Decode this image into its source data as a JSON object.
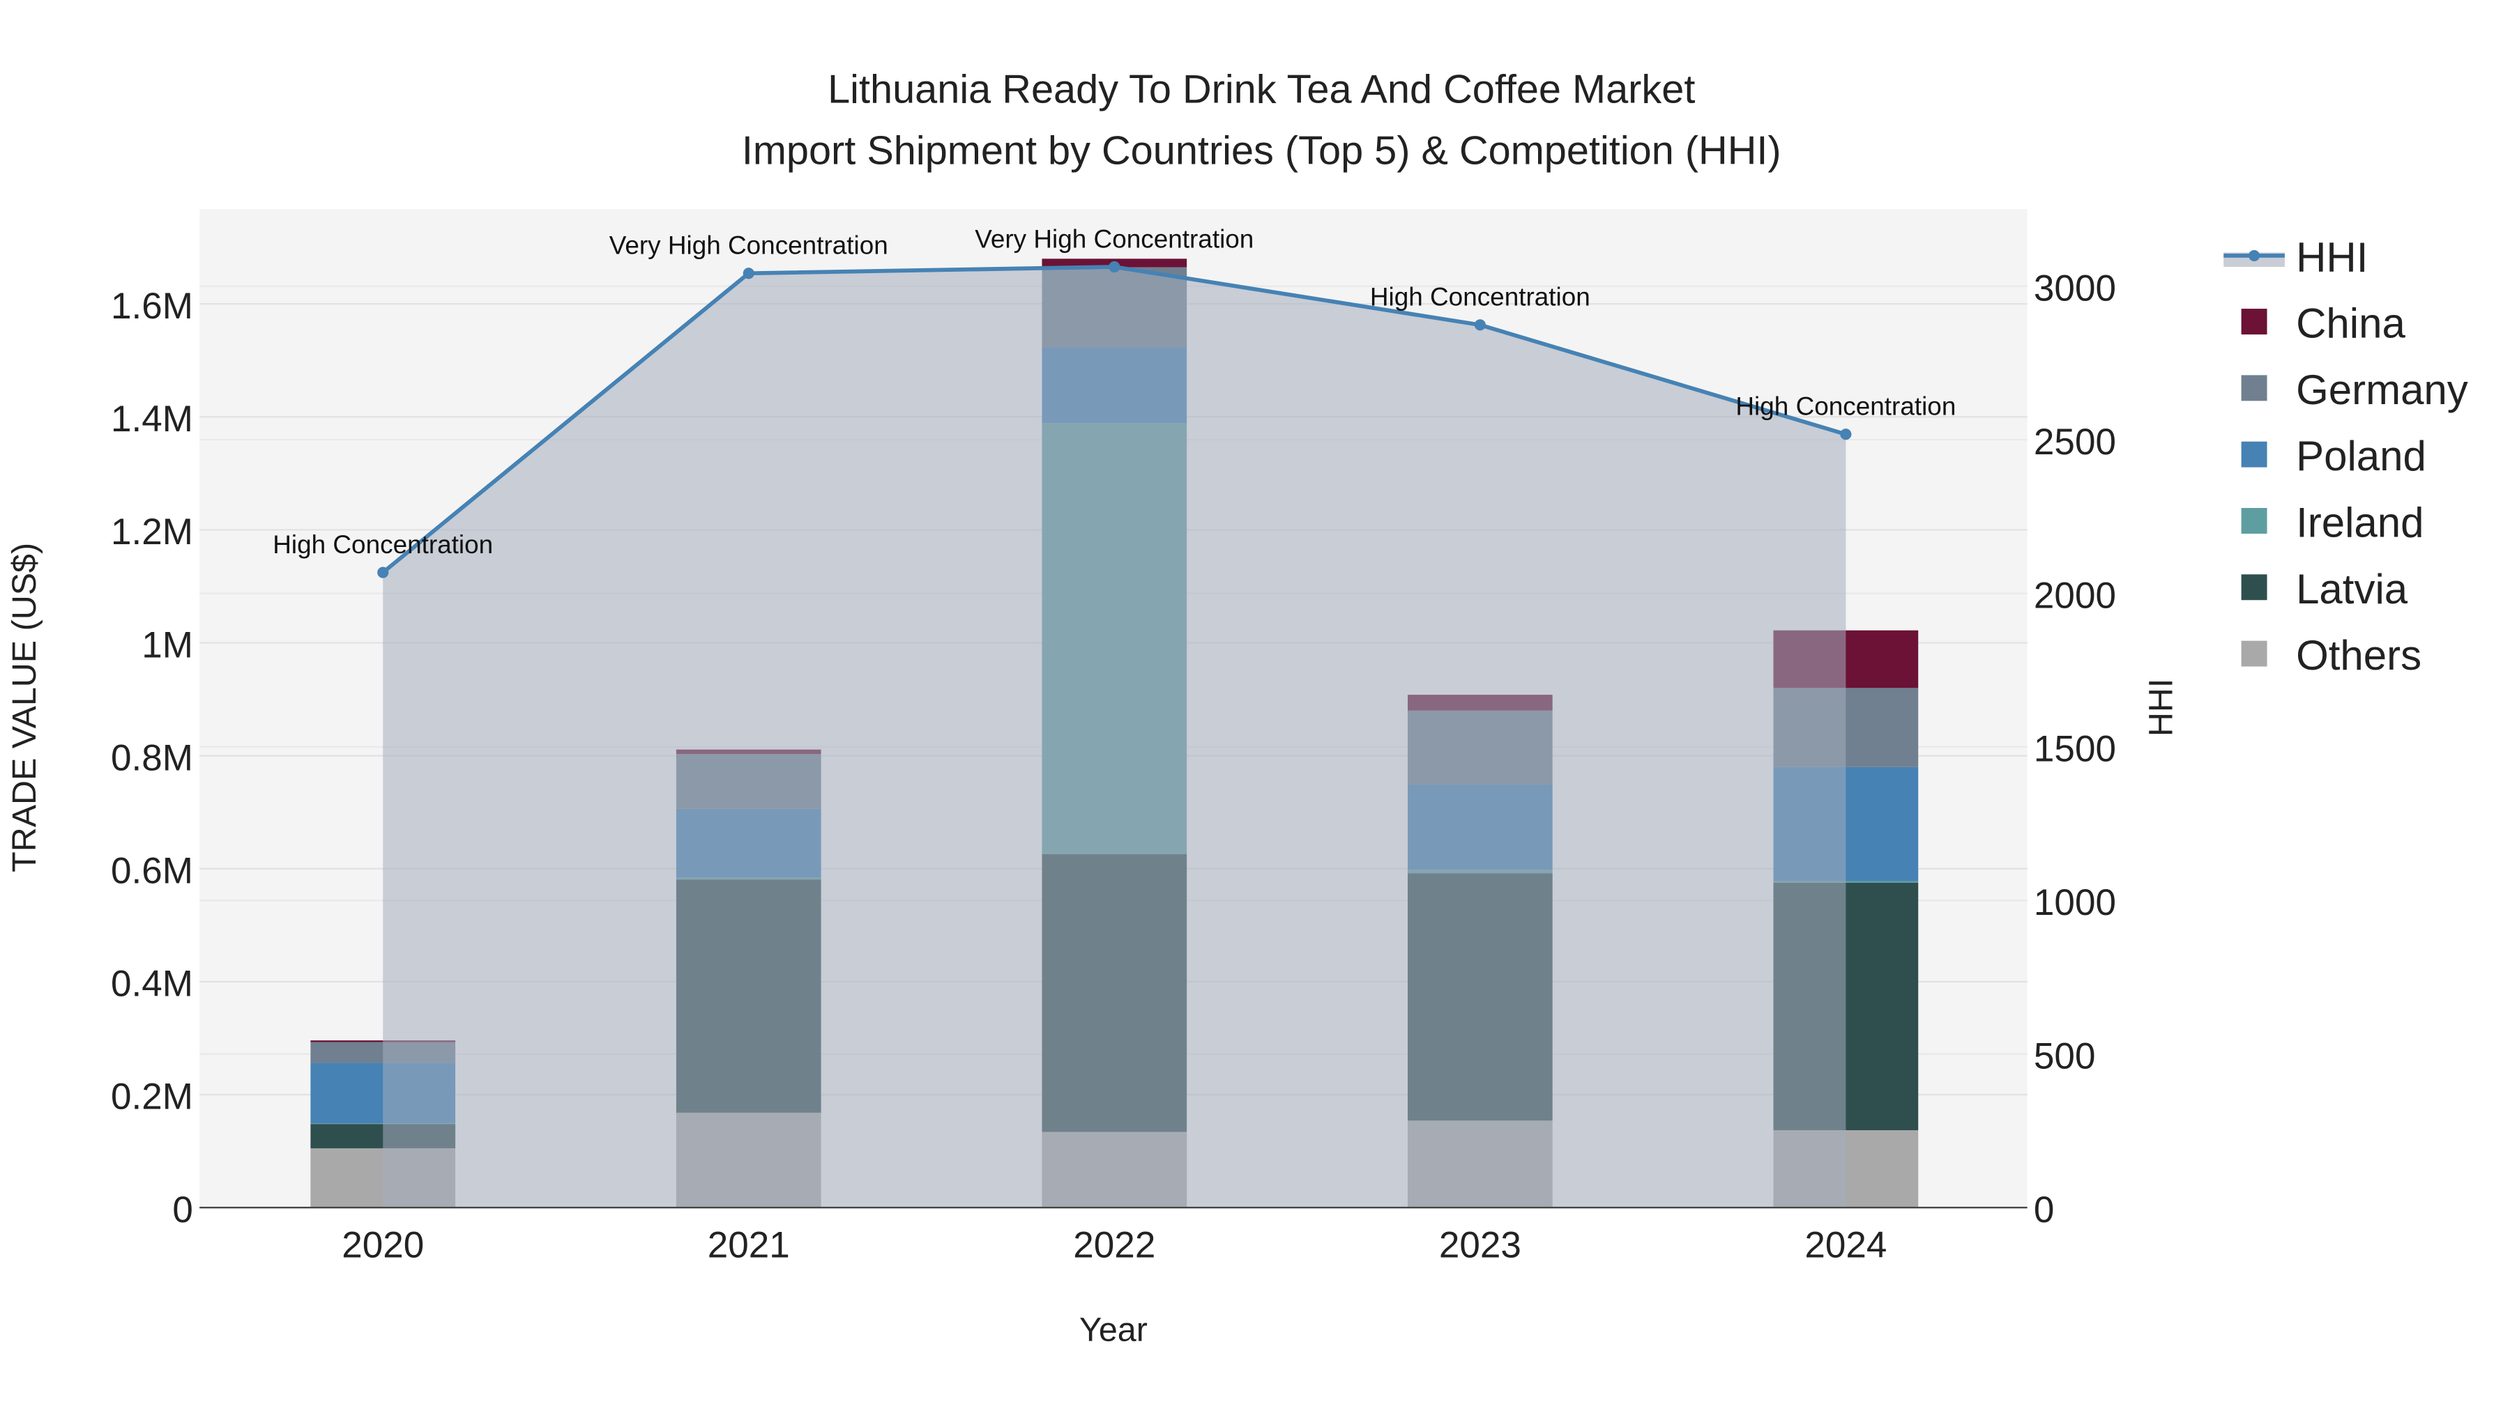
{
  "chart_data": {
    "type": "bar",
    "stacked": true,
    "title_line1": "Lithuania Ready To Drink Tea And Coffee Market",
    "title_line2": "Import Shipment by Countries (Top 5) & Competition (HHI)",
    "xlabel": "Year",
    "ylabel": "TRADE VALUE (US$)",
    "y2label": "HHI",
    "categories": [
      "2020",
      "2021",
      "2022",
      "2023",
      "2024"
    ],
    "ylim": [
      0,
      1760000
    ],
    "y2lim": [
      0,
      3240
    ],
    "yticks": [
      0,
      200000,
      400000,
      600000,
      800000,
      1000000,
      1200000,
      1400000,
      1600000
    ],
    "ytick_labels": [
      "0",
      "0.2M",
      "0.4M",
      "0.6M",
      "0.8M",
      "1M",
      "1.2M",
      "1.4M",
      "1.6M"
    ],
    "y2ticks": [
      0,
      500,
      1000,
      1500,
      2000,
      2500,
      3000
    ],
    "y2tick_labels": [
      "0",
      "500",
      "1000",
      "1500",
      "2000",
      "2500",
      "3000"
    ],
    "series": [
      {
        "name": "Others",
        "color": "#a9a9a9",
        "values": [
          105000,
          168000,
          134000,
          154000,
          137000
        ]
      },
      {
        "name": "Latvia",
        "color": "#2f4f4f",
        "values": [
          43000,
          413000,
          492000,
          438000,
          438000
        ]
      },
      {
        "name": "Ireland",
        "color": "#5f9ea0",
        "values": [
          1000,
          3000,
          763000,
          6000,
          3000
        ]
      },
      {
        "name": "Poland",
        "color": "#4682b4",
        "values": [
          107000,
          122000,
          134000,
          151000,
          202000
        ]
      },
      {
        "name": "Germany",
        "color": "#708090",
        "values": [
          37000,
          97000,
          142000,
          131000,
          140000
        ]
      },
      {
        "name": "China",
        "color": "#6b1236",
        "values": [
          3000,
          8000,
          15000,
          28000,
          102000
        ]
      }
    ],
    "legend_order": [
      "HHI",
      "China",
      "Germany",
      "Poland",
      "Ireland",
      "Latvia",
      "Others"
    ],
    "legend_placement": "right",
    "hhi": {
      "name": "HHI",
      "color": "#4682b4",
      "values": [
        2068,
        3042,
        3063,
        2874,
        2518
      ],
      "labels": [
        "High Concentration",
        "Very High Concentration",
        "Very High Concentration",
        "High Concentration",
        "High Concentration"
      ]
    },
    "grid": true
  }
}
